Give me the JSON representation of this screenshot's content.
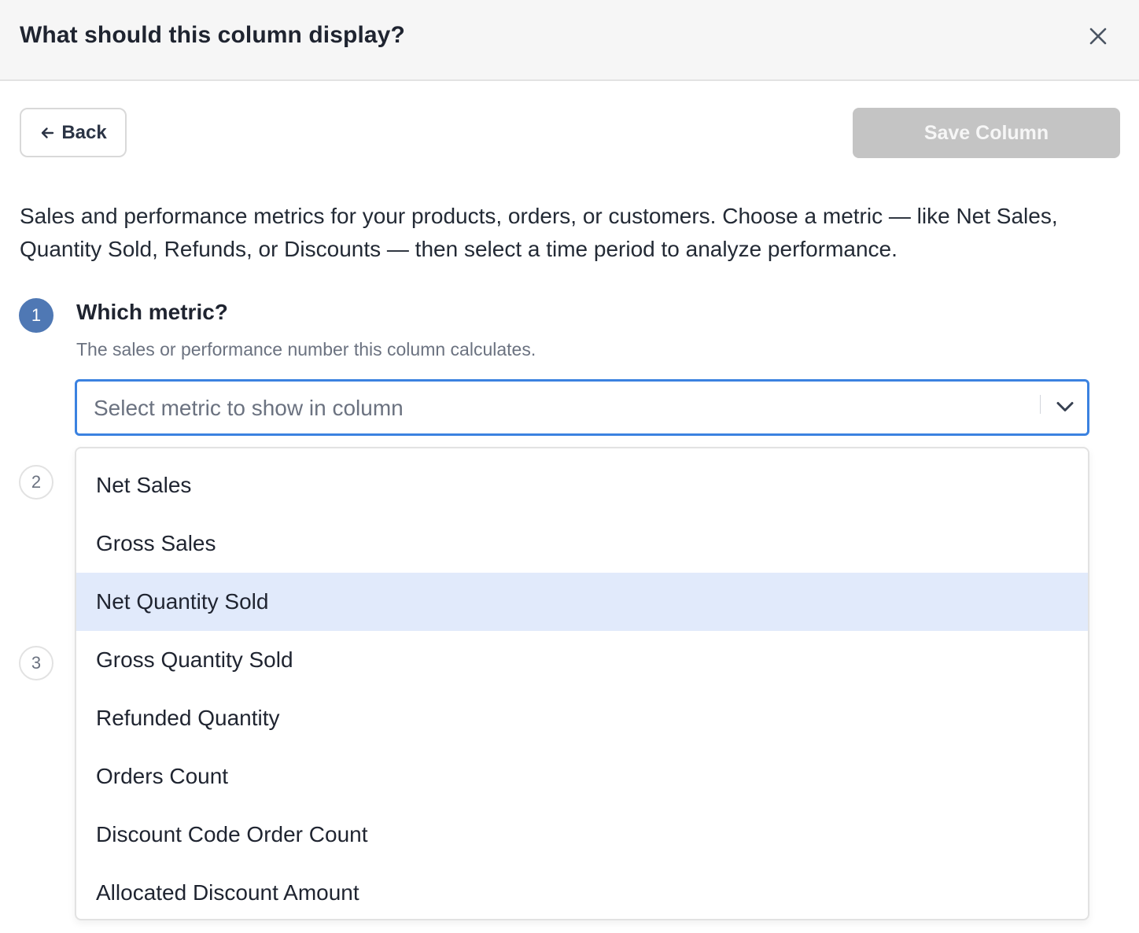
{
  "header": {
    "title": "What should this column display?",
    "close_icon": "close-icon"
  },
  "toolbar": {
    "back_label": "Back",
    "save_label": "Save Column",
    "save_disabled": true
  },
  "description": "Sales and performance metrics for your products, orders, or customers. Choose a metric — like Net Sales, Quantity Sold, Refunds, or Discounts — then select a time period to analyze performance.",
  "steps": [
    {
      "number": "1",
      "title": "Which metric?",
      "subtitle": "The sales or performance number this column calculates.",
      "active": true
    },
    {
      "number": "2",
      "active": false
    },
    {
      "number": "3",
      "active": false
    }
  ],
  "metric_select": {
    "placeholder": "Select metric to show in column",
    "open": true,
    "highlighted_index": 2,
    "options": [
      "Net Sales",
      "Gross Sales",
      "Net Quantity Sold",
      "Gross Quantity Sold",
      "Refunded Quantity",
      "Orders Count",
      "Discount Code Order Count",
      "Allocated Discount Amount"
    ]
  },
  "colors": {
    "accent": "#3b82e0",
    "step_active": "#4f78b4",
    "highlight": "#e1eafb",
    "disabled_button": "#c4c4c4"
  }
}
